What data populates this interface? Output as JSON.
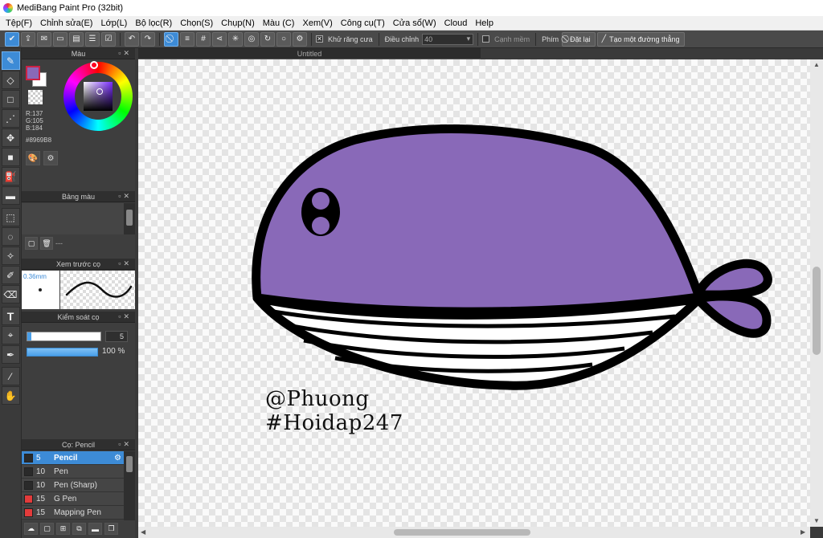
{
  "window": {
    "title": "MediBang Paint Pro (32bit)"
  },
  "menu": [
    "Tệp(F)",
    "Chỉnh sửa(E)",
    "Lớp(L)",
    "Bộ lọc(R)",
    "Chọn(S)",
    "Chụp(N)",
    "Màu (C)",
    "Xem(V)",
    "Công cụ(T)",
    "Cửa sổ(W)",
    "Cloud",
    "Help"
  ],
  "toolbar": {
    "antialias_label": "Khử răng cưa",
    "correction_label": "Điều chỉnh",
    "correction_value": "40",
    "softedge_label": "Cạnh mềm",
    "key_label": "Phím",
    "reset_label": "Đặt lại",
    "line_label": "Tạo một đường thẳng"
  },
  "document": {
    "tab_title": "Untitled"
  },
  "color_panel": {
    "title": "Màu",
    "r": "R:137",
    "g": "G:105",
    "b": "B:184",
    "hex": "#8969B8",
    "current_color": "#8969b8"
  },
  "palette_panel": {
    "title": "Bảng màu",
    "more": "---"
  },
  "preview_panel": {
    "title": "Xem trước cọ",
    "size": "0.36mm"
  },
  "brush_control": {
    "title": "Kiểm soát cọ",
    "size_value": "5",
    "opacity_value": "100 %",
    "size_fraction": 0.05,
    "opacity_fraction": 1.0
  },
  "brush_panel": {
    "title": "Cọ: Pencil",
    "items": [
      {
        "size": "5",
        "name": "Pencil",
        "swatch": "#2a2a2a",
        "selected": true
      },
      {
        "size": "10",
        "name": "Pen",
        "swatch": "#2a2a2a",
        "selected": false
      },
      {
        "size": "10",
        "name": "Pen (Sharp)",
        "swatch": "#2a2a2a",
        "selected": false
      },
      {
        "size": "15",
        "name": "G Pen",
        "swatch": "#e33b3b",
        "selected": false
      },
      {
        "size": "15",
        "name": "Mapping Pen",
        "swatch": "#e33b3b",
        "selected": false
      }
    ]
  },
  "artwork": {
    "whale_body_color": "#8969b8",
    "outline_color": "#000000",
    "caption_line1": "@Phuong",
    "caption_line2": "#Hoidap247"
  }
}
